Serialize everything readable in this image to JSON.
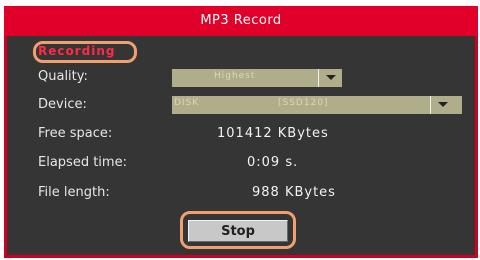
{
  "dialog": {
    "title": "MP3 Record"
  },
  "status": {
    "tag": "Recording"
  },
  "quality": {
    "label": "Quality:",
    "value": "Highest"
  },
  "device": {
    "label": "Device:",
    "value_left": "DISK",
    "value_right": "[SSD120]"
  },
  "free_space": {
    "label": "Free space:",
    "value": "101412 KBytes"
  },
  "elapsed": {
    "label": "Elapsed time:",
    "value": "0:09 s."
  },
  "file_length": {
    "label": "File length:",
    "value": "988 KBytes"
  },
  "actions": {
    "stop_label": "Stop"
  },
  "colors": {
    "accent": "#e0002a",
    "highlight": "#f0a070",
    "panel": "#353535"
  }
}
